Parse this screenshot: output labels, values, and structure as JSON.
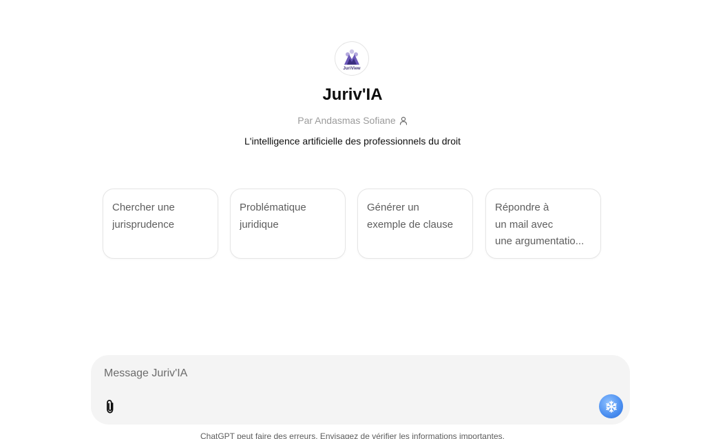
{
  "gpt": {
    "logo_text": "JuriView",
    "name": "Juriv'IA",
    "author": "Par Andasmas Sofiane",
    "author_icon": "person-icon",
    "description": "L'intelligence artificielle des professionnels du droit"
  },
  "starters": [
    {
      "lines": [
        "Chercher une",
        "jurisprudence"
      ]
    },
    {
      "lines": [
        "Problématique",
        "juridique"
      ]
    },
    {
      "lines": [
        "Générer un",
        "exemple de clause"
      ]
    },
    {
      "lines": [
        "Répondre à",
        "un mail avec",
        "une argumentatio..."
      ]
    }
  ],
  "composer": {
    "placeholder": "Message Juriv'IA",
    "attach_icon": "paperclip-icon",
    "send_icon": "snowflake-icon",
    "send_color": "#4a8ef0",
    "background": "#f4f4f4"
  },
  "footer": {
    "note": "ChatGPT peut faire des erreurs. Envisagez de vérifier les informations importantes."
  }
}
